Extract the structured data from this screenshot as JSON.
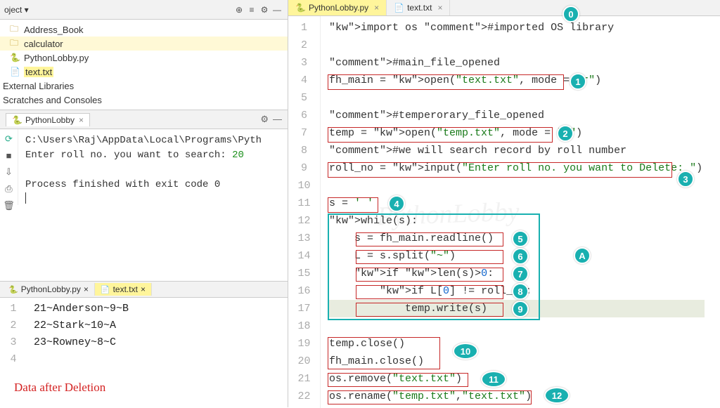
{
  "project_toolbar": {
    "label": "oject ▾"
  },
  "tree": {
    "address_book": "Address_Book",
    "calculator": "calculator",
    "pythonlobby": "PythonLobby.py",
    "text_txt": "text.txt",
    "ext_lib": "External Libraries",
    "scratches": "Scratches and Consoles"
  },
  "run": {
    "tab": "PythonLobby",
    "l1": "C:\\Users\\Raj\\AppData\\Local\\Programs\\Pyth",
    "l2a": "Enter roll no. you want to search: ",
    "l2b": "20",
    "l3": "Process finished with exit code 0"
  },
  "bottom_tabs": {
    "t1": "PythonLobby.py",
    "t2": "text.txt"
  },
  "txtfile": {
    "l1": "21~Anderson~9~B",
    "l2": "22~Stark~10~A",
    "l3": "23~Rowney~8~C"
  },
  "data_caption": "Data after Deletion",
  "ed_tabs": {
    "t1": "PythonLobby.py",
    "t2": "text.txt"
  },
  "code": {
    "l1": "import os #imported OS library",
    "l2": "",
    "l3": "#main_file_opened",
    "l4": "fh_main = open(\"text.txt\", mode = \"r\")",
    "l5": "",
    "l6": "#temperorary_file_opened",
    "l7": "temp = open(\"temp.txt\", mode = \"w\")",
    "l8": "#we will search record by roll number",
    "l9": "roll_no = input(\"Enter roll no. you want to Delete: \")",
    "l10": "",
    "l11": "s = ' '",
    "l12": "while(s):",
    "l13": "    s = fh_main.readline()",
    "l14": "    L = s.split(\"~\")",
    "l15": "    if len(s)>0:",
    "l16": "        if L[0] != roll_no:",
    "l17": "            temp.write(s)",
    "l18": "",
    "l19": "temp.close()",
    "l20": "fh_main.close()",
    "l21": "os.remove(\"text.txt\")",
    "l22": "os.rename(\"temp.txt\",\"text.txt\")"
  },
  "bubbles": {
    "b0": "0",
    "b1": "1",
    "b2": "2",
    "b3": "3",
    "b4": "4",
    "b5": "5",
    "b6": "6",
    "b7": "7",
    "b8": "8",
    "b9": "9",
    "b10": "10",
    "b11": "11",
    "b12": "12",
    "bA": "A"
  },
  "watermark": "PythonLobby"
}
